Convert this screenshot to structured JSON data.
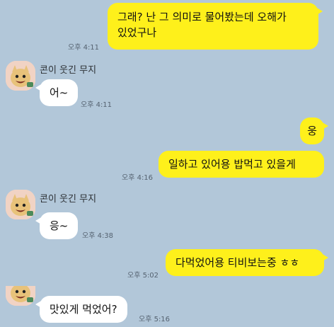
{
  "chat": {
    "contact_name": "콘이 웃긴 무지",
    "messages": [
      {
        "sender": "me",
        "text_line1": "그래? 난 그 의미로 물어봤는데 오해가",
        "text_line2": "있었구나",
        "time": "오후 4:11"
      },
      {
        "sender": "them",
        "text": "어~",
        "time": "오후 4:11"
      },
      {
        "sender": "me",
        "text": "웅"
      },
      {
        "sender": "me",
        "text": "일하고 있어용 밥먹고 있을게",
        "time": "오후 4:16"
      },
      {
        "sender": "them",
        "text": "응~",
        "time": "오후 4:38"
      },
      {
        "sender": "me",
        "text": "다먹었어용 티비보는중 ㅎㅎ",
        "time": "오후 5:02"
      },
      {
        "sender": "them",
        "text": "맛있게 먹었어?",
        "time": "오후 5:16"
      }
    ]
  },
  "colors": {
    "background": "#b2c7d9",
    "my_bubble": "#fef01b",
    "their_bubble": "#ffffff"
  },
  "icons": {
    "avatar": "muzi-avatar-icon"
  }
}
